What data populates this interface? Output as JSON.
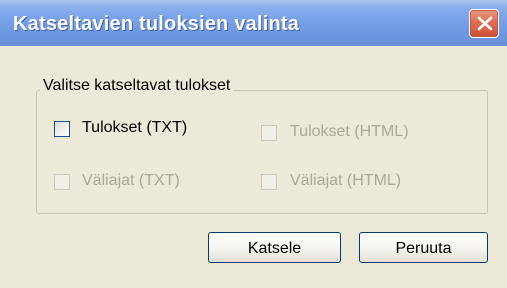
{
  "window": {
    "title": "Katseltavien tuloksien valinta",
    "close_icon": "close-icon"
  },
  "group": {
    "legend": "Valitse katseltavat tulokset",
    "options": [
      {
        "label": "Tulokset (TXT)",
        "enabled": true,
        "checked": false
      },
      {
        "label": "Tulokset (HTML)",
        "enabled": false,
        "checked": false
      },
      {
        "label": "Väliajat (TXT)",
        "enabled": false,
        "checked": false
      },
      {
        "label": "Väliajat (HTML)",
        "enabled": false,
        "checked": false
      }
    ]
  },
  "buttons": {
    "view_label": "Katsele",
    "cancel_label": "Peruuta"
  },
  "colors": {
    "titlebar": "#7aa2e8",
    "close_button": "#dd6f52",
    "dialog_background": "#ece9d8",
    "disabled_text": "#aca899"
  }
}
